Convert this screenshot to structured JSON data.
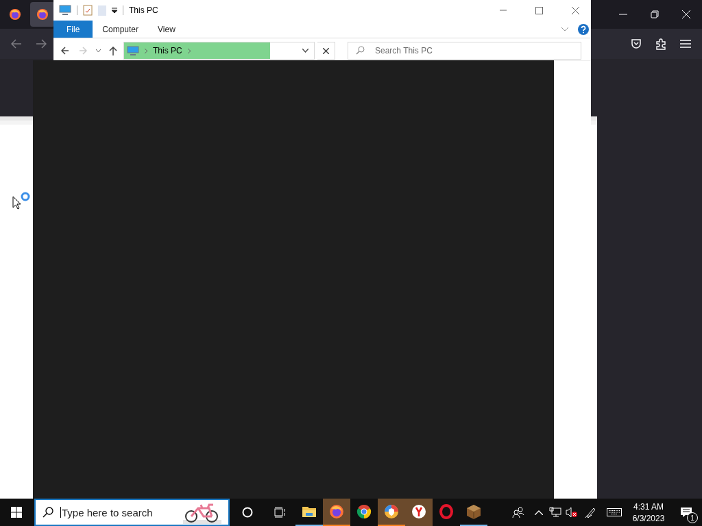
{
  "browser": {
    "tabs": [
      {
        "selected": false
      },
      {
        "selected": true
      }
    ]
  },
  "explorer": {
    "title": "This PC",
    "ribbon_tabs": [
      {
        "label": "File",
        "selected": true
      },
      {
        "label": "Computer",
        "selected": false
      },
      {
        "label": "View",
        "selected": false
      }
    ],
    "back_disabled": false,
    "forward_disabled": true,
    "address": {
      "crumb": "This PC",
      "level": 0.77
    },
    "search": {
      "placeholder": "Search This PC"
    }
  },
  "taskbar": {
    "search": {
      "placeholder": "Type here to search"
    },
    "apps": [
      {
        "kind": "folder",
        "running": true,
        "flashing": false
      },
      {
        "kind": "fox",
        "running": true,
        "flashing": true
      },
      {
        "kind": "chrome",
        "running": false,
        "flashing": false
      },
      {
        "kind": "shield",
        "running": true,
        "flashing": true
      },
      {
        "kind": "y",
        "running": false,
        "flashing": true
      },
      {
        "kind": "ring",
        "running": false,
        "flashing": false
      },
      {
        "kind": "crate",
        "running": true,
        "flashing": false
      }
    ],
    "volume_muted": true,
    "clock": {
      "time": "4:31 AM",
      "date": "6/3/2023"
    },
    "notifications": "1"
  }
}
